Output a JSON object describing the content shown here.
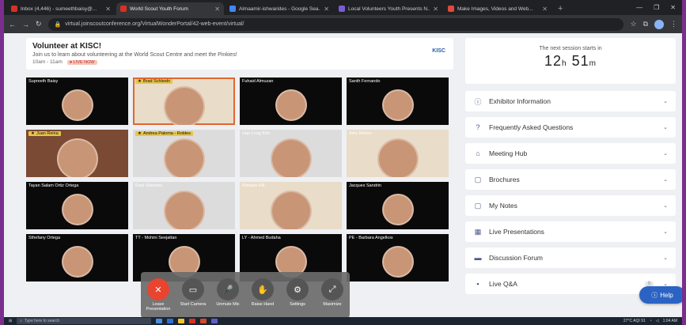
{
  "browser": {
    "tabs": [
      {
        "title": "Inbox (4,446) - sumeethbaisy@...",
        "color": "#d93025",
        "active": false
      },
      {
        "title": "World Scout Youth Forum",
        "color": "#d93025",
        "active": true
      },
      {
        "title": "Almaamir-ishwarides - Google Sea...",
        "color": "#4285f4",
        "active": false
      },
      {
        "title": "Local Volunteers Youth Presents N...",
        "color": "#7b5cd6",
        "active": false
      },
      {
        "title": "Make Images, Videos and Web...",
        "color": "#e04a3a",
        "active": false
      }
    ],
    "url": "virtual.joinscoutconference.org/VirtualWonderPortal/42-web-event/virtual/"
  },
  "banner": {
    "title": "Volunteer at KISC!",
    "subtitle": "Join us to learn about volunteering at the World Scout Centre and meet the Pinkies!",
    "time": "10am - 11am",
    "live_label": "● LIVE NOW",
    "logo": "KISC"
  },
  "participants": [
    {
      "name": "Supreeth Baisy",
      "star": false,
      "bg": "dark"
    },
    {
      "name": "Brad Schleeln",
      "star": true,
      "bg": "cream",
      "highlight": true
    },
    {
      "name": "Fuhaid Almuzan",
      "star": false,
      "bg": "dark"
    },
    {
      "name": "Santh Fernando",
      "star": false,
      "bg": "dark"
    },
    {
      "name": "Juan Reina",
      "star": true,
      "bg": "warm"
    },
    {
      "name": "Andrea Paloma - Robles",
      "star": true,
      "bg": "lite"
    },
    {
      "name": "Han Long Koh",
      "star": false,
      "bg": "lite"
    },
    {
      "name": "Amy Rahoo",
      "star": false,
      "bg": "cream"
    },
    {
      "name": "Tayan Salam Ortiz Ortega",
      "star": false,
      "bg": "dark"
    },
    {
      "name": "Raul Sánchez",
      "star": false,
      "bg": "lite"
    },
    {
      "name": "Rohaan Hill",
      "star": false,
      "bg": "cream"
    },
    {
      "name": "Jacques Sandrin",
      "star": false,
      "bg": "dark"
    },
    {
      "name": "Sthefany Ortega",
      "star": false,
      "bg": "dark"
    },
    {
      "name": "TT - Mohini Seejattan",
      "star": false,
      "bg": "dark"
    },
    {
      "name": "LY - Ahmed Budaha",
      "star": false,
      "bg": "dark"
    },
    {
      "name": "PE - Barbara Angelkos",
      "star": false,
      "bg": "dark"
    }
  ],
  "controls": [
    {
      "label": "Leave Presentation",
      "icon": "close-icon",
      "glyph": "✕",
      "red": true
    },
    {
      "label": "Start Camera",
      "icon": "camera-icon",
      "glyph": "▭",
      "red": false
    },
    {
      "label": "Unmute Mic",
      "icon": "mic-off-icon",
      "glyph": "🎤",
      "red": false
    },
    {
      "label": "Raise Hand",
      "icon": "hand-icon",
      "glyph": "✋",
      "red": false
    },
    {
      "label": "Settings",
      "icon": "gear-icon",
      "glyph": "⚙",
      "red": false
    },
    {
      "label": "Maximize",
      "icon": "maximize-icon",
      "glyph": "⤢",
      "red": false
    }
  ],
  "countdown": {
    "caption": "The next session starts in",
    "hours": "12",
    "h_unit": "h",
    "minutes": "51",
    "m_unit": "m"
  },
  "sidebar": {
    "items": [
      {
        "label": "Exhibitor Information",
        "icon": "info-icon",
        "glyph": "ⓘ"
      },
      {
        "label": "Frequently Asked Questions",
        "icon": "question-icon",
        "glyph": "?"
      },
      {
        "label": "Meeting Hub",
        "icon": "meeting-icon",
        "glyph": "⌂"
      },
      {
        "label": "Brochures",
        "icon": "brochure-icon",
        "glyph": "▢"
      },
      {
        "label": "My Notes",
        "icon": "notes-icon",
        "glyph": "▢"
      },
      {
        "label": "Live Presentations",
        "icon": "presentation-icon",
        "glyph": "▦"
      },
      {
        "label": "Discussion Forum",
        "icon": "forum-icon",
        "glyph": "▬"
      },
      {
        "label": "Live Q&A",
        "icon": "qa-icon",
        "glyph": "▪"
      }
    ],
    "qa_badge": "0"
  },
  "help_label": "Help",
  "taskbar": {
    "search_placeholder": "Type here to search",
    "weather": "27°C AQI 91",
    "time": "1:04 AM"
  }
}
